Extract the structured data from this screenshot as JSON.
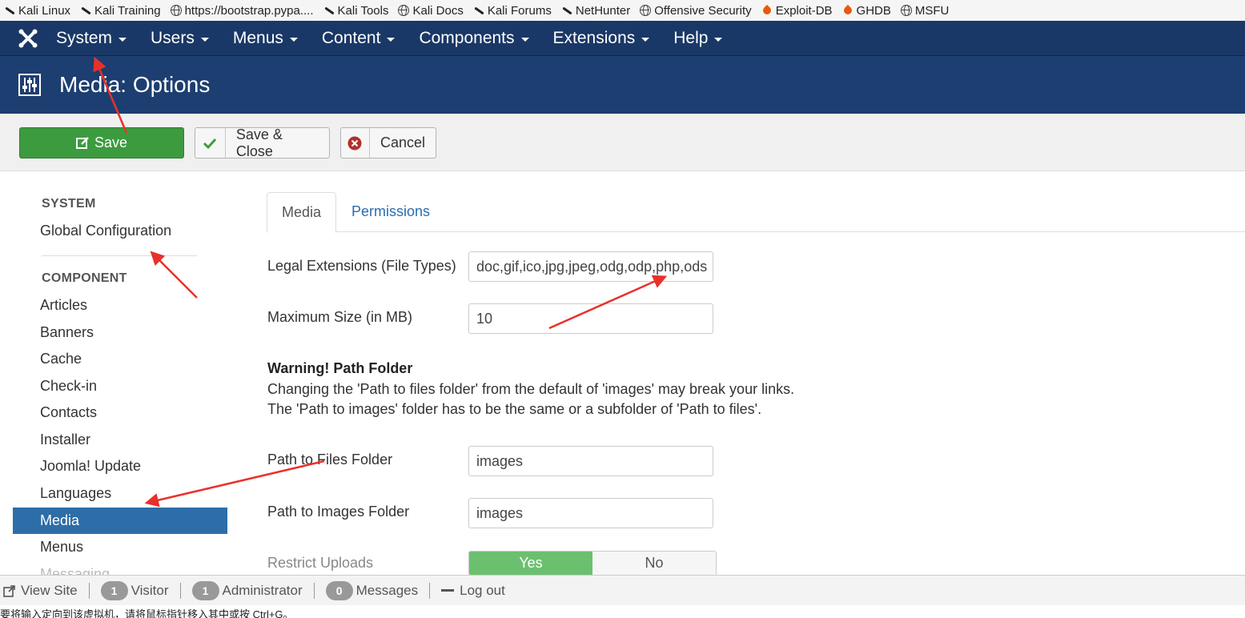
{
  "bookmarks": [
    {
      "label": "Kali Linux",
      "icon": "kali-dragon-icon"
    },
    {
      "label": "Kali Training",
      "icon": "kali-dragon-icon"
    },
    {
      "label": "https://bootstrap.pypa....",
      "icon": "globe-icon"
    },
    {
      "label": "Kali Tools",
      "icon": "kali-dragon-icon"
    },
    {
      "label": "Kali Docs",
      "icon": "globe-icon"
    },
    {
      "label": "Kali Forums",
      "icon": "kali-dragon-icon"
    },
    {
      "label": "NetHunter",
      "icon": "kali-dragon-icon"
    },
    {
      "label": "Offensive Security",
      "icon": "globe-icon"
    },
    {
      "label": "Exploit-DB",
      "icon": "flame-icon"
    },
    {
      "label": "GHDB",
      "icon": "flame-icon"
    },
    {
      "label": "MSFU",
      "icon": "globe-icon"
    }
  ],
  "nav": {
    "items": [
      "System",
      "Users",
      "Menus",
      "Content",
      "Components",
      "Extensions",
      "Help"
    ]
  },
  "page": {
    "title": "Media: Options"
  },
  "toolbar": {
    "save": "Save",
    "save_close": "Save & Close",
    "cancel": "Cancel"
  },
  "sidebar": {
    "system_heading": "SYSTEM",
    "global_config": "Global Configuration",
    "component_heading": "COMPONENT",
    "items": [
      "Articles",
      "Banners",
      "Cache",
      "Check-in",
      "Contacts",
      "Installer",
      "Joomla! Update",
      "Languages",
      "Media",
      "Menus",
      "Messaging"
    ],
    "active": "Media"
  },
  "tabs": {
    "media": "Media",
    "permissions": "Permissions"
  },
  "form": {
    "legal_ext_label": "Legal Extensions (File Types)",
    "legal_ext_value": "doc,gif,ico,jpg,jpeg,odg,odp,php,ods",
    "max_size_label": "Maximum Size (in MB)",
    "max_size_value": "10",
    "warning_title": "Warning! Path Folder",
    "warning_line1": "Changing the 'Path to files folder' from the default of 'images' may break your links.",
    "warning_line2": "The 'Path to images' folder has to be the same or a subfolder of 'Path to files'.",
    "files_folder_label": "Path to Files Folder",
    "files_folder_value": "images",
    "images_folder_label": "Path to Images Folder",
    "images_folder_value": "images",
    "restrict_label": "Restrict Uploads",
    "restrict_yes": "Yes",
    "restrict_no": "No"
  },
  "status": {
    "view_site": "View Site",
    "visitor_count": "1",
    "visitor_label": "Visitor",
    "admin_count": "1",
    "admin_label": "Administrator",
    "messages_count": "0",
    "messages_label": "Messages",
    "logout": "Log out"
  },
  "hint": "要将输入定向到该虚拟机，请将鼠标指针移入其中或按 Ctrl+G。",
  "colors": {
    "navbar": "#1a3867",
    "titlebar": "#1d3e70",
    "save_green": "#3c9b3e",
    "active_blue": "#2d6da8",
    "annotation_red": "#e8312a"
  }
}
